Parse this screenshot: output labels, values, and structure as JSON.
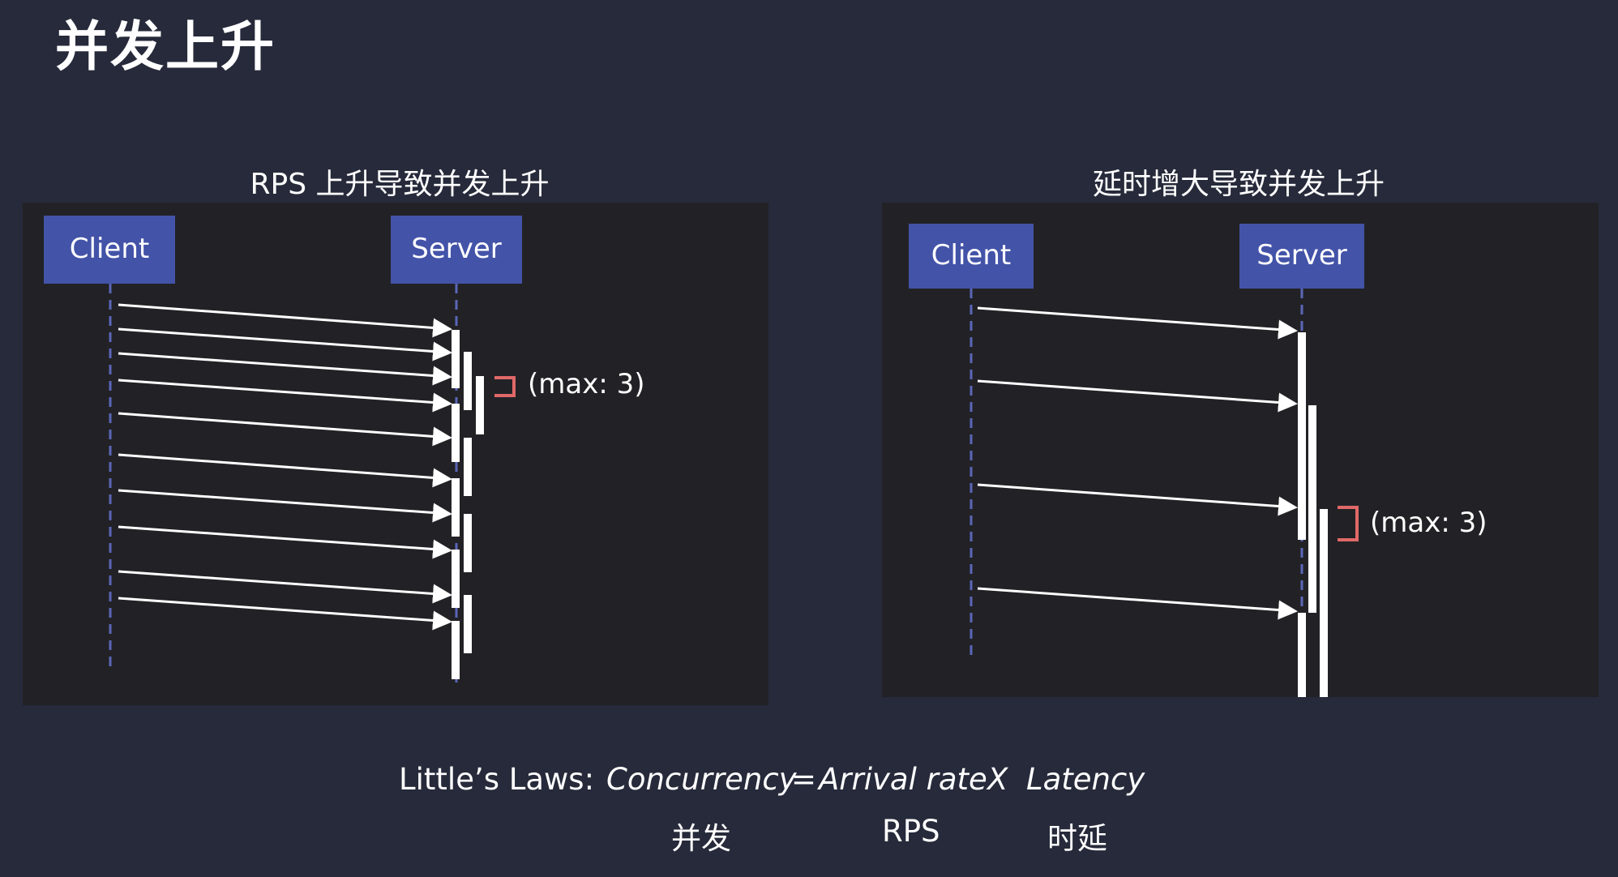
{
  "slide": {
    "title": "并发上升"
  },
  "left_panel": {
    "title": "RPS 上升导致并发上升",
    "client_label": "Client",
    "server_label": "Server",
    "annotation": "(max: 3)"
  },
  "right_panel": {
    "title": "延时增大导致并发上升",
    "client_label": "Client",
    "server_label": "Server",
    "annotation": "(max: 3)"
  },
  "formula": {
    "prefix": "Little’s Laws:",
    "concurrency": "Concurrency",
    "equals": "=",
    "arrival_rate": "Arrival rate",
    "times": "X",
    "latency": "Latency",
    "concurrency_zh": "并发",
    "rps": "RPS",
    "latency_zh": "时延"
  },
  "colors": {
    "background": "#262a3a",
    "panel": "#222226",
    "box": "#4353a8",
    "bracket": "#e06868",
    "dashed": "#5a67b8"
  }
}
